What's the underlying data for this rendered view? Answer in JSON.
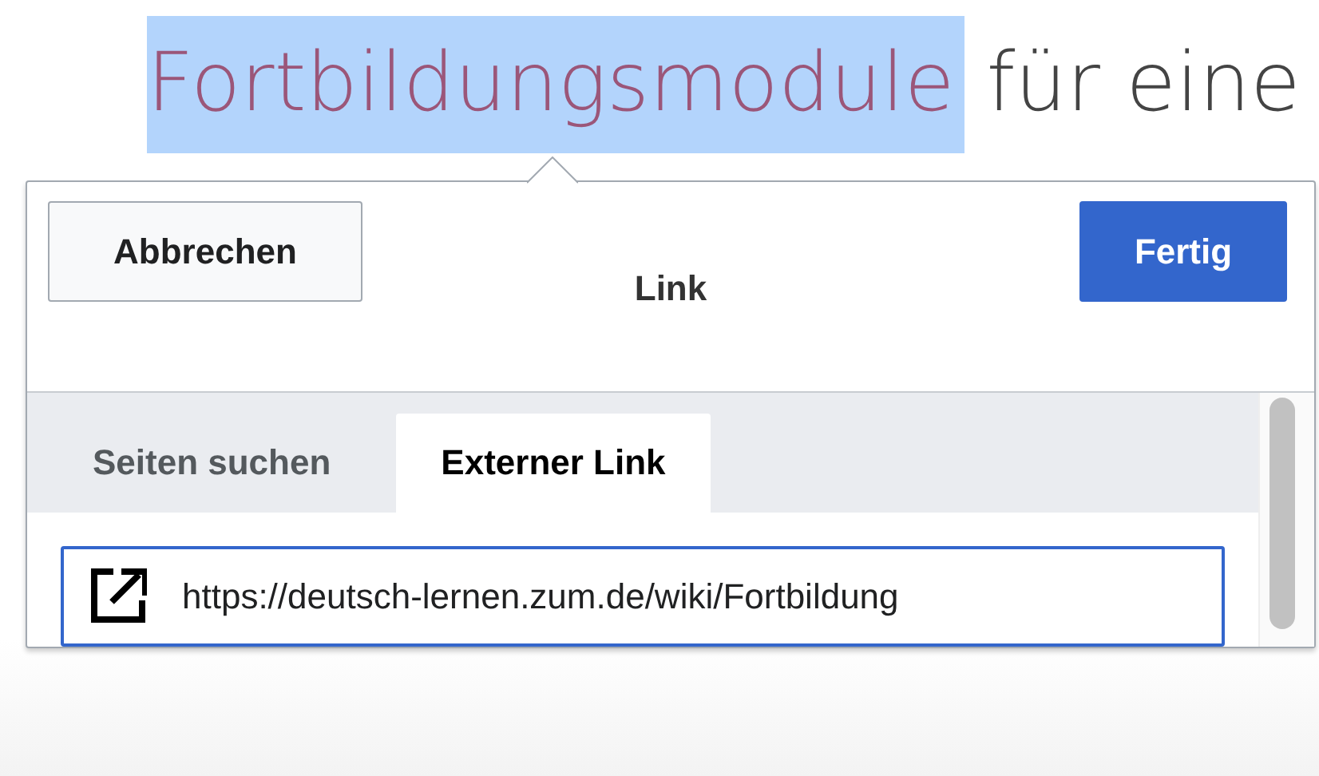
{
  "heading": {
    "selected_word": "Fortbildungsmodule",
    "rest": "für eine"
  },
  "dialog": {
    "title": "Link",
    "cancel_button": "Abbrechen",
    "done_button": "Fertig",
    "tabs": [
      {
        "label": "Seiten suchen",
        "selected": false
      },
      {
        "label": "Externer Link",
        "selected": true
      }
    ],
    "url_field": {
      "value": "https://deutsch-lernen.zum.de/wiki/Fortbildung"
    }
  }
}
